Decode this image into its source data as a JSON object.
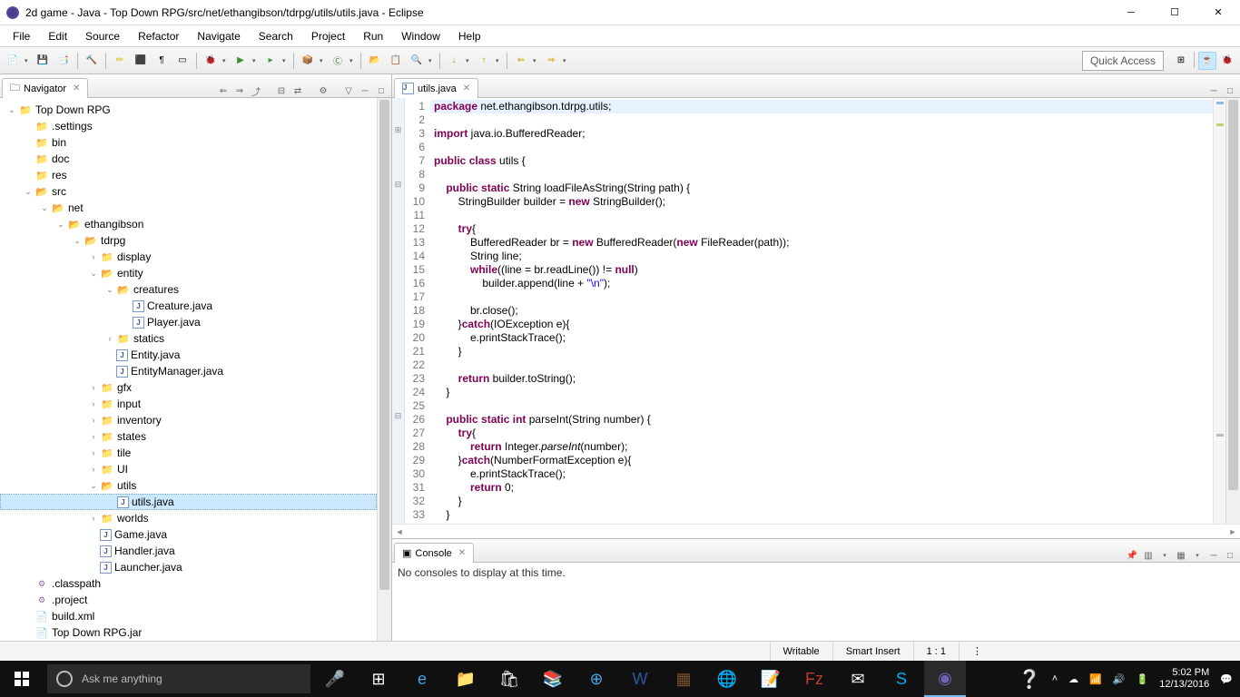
{
  "window": {
    "title": "2d game - Java - Top Down RPG/src/net/ethangibson/tdrpg/utils/utils.java - Eclipse"
  },
  "menu": [
    "File",
    "Edit",
    "Source",
    "Refactor",
    "Navigate",
    "Search",
    "Project",
    "Run",
    "Window",
    "Help"
  ],
  "quick_access": "Quick Access",
  "navigator": {
    "title": "Navigator",
    "tree": [
      {
        "d": 0,
        "t": "tw",
        "l": "Top Down RPG",
        "i": "proj",
        "exp": true
      },
      {
        "d": 1,
        "t": "lf",
        "l": ".settings",
        "i": "folder"
      },
      {
        "d": 1,
        "t": "lf",
        "l": "bin",
        "i": "folder"
      },
      {
        "d": 1,
        "t": "lf",
        "l": "doc",
        "i": "folder"
      },
      {
        "d": 1,
        "t": "lf",
        "l": "res",
        "i": "folder"
      },
      {
        "d": 1,
        "t": "tw",
        "l": "src",
        "i": "folder-open",
        "exp": true
      },
      {
        "d": 2,
        "t": "tw",
        "l": "net",
        "i": "folder-open",
        "exp": true
      },
      {
        "d": 3,
        "t": "tw",
        "l": "ethangibson",
        "i": "folder-open",
        "exp": true
      },
      {
        "d": 4,
        "t": "tw",
        "l": "tdrpg",
        "i": "folder-open",
        "exp": true
      },
      {
        "d": 5,
        "t": "lf",
        "l": "display",
        "i": "folder",
        "ch": true
      },
      {
        "d": 5,
        "t": "tw",
        "l": "entity",
        "i": "folder-open",
        "exp": true
      },
      {
        "d": 6,
        "t": "tw",
        "l": "creatures",
        "i": "folder-open",
        "exp": true
      },
      {
        "d": 7,
        "t": "lf",
        "l": "Creature.java",
        "i": "java"
      },
      {
        "d": 7,
        "t": "lf",
        "l": "Player.java",
        "i": "java"
      },
      {
        "d": 6,
        "t": "lf",
        "l": "statics",
        "i": "folder",
        "ch": true
      },
      {
        "d": 6,
        "t": "lf",
        "l": "Entity.java",
        "i": "java"
      },
      {
        "d": 6,
        "t": "lf",
        "l": "EntityManager.java",
        "i": "java"
      },
      {
        "d": 5,
        "t": "lf",
        "l": "gfx",
        "i": "folder",
        "ch": true
      },
      {
        "d": 5,
        "t": "lf",
        "l": "input",
        "i": "folder",
        "ch": true
      },
      {
        "d": 5,
        "t": "lf",
        "l": "inventory",
        "i": "folder",
        "ch": true
      },
      {
        "d": 5,
        "t": "lf",
        "l": "states",
        "i": "folder",
        "ch": true
      },
      {
        "d": 5,
        "t": "lf",
        "l": "tile",
        "i": "folder",
        "ch": true
      },
      {
        "d": 5,
        "t": "lf",
        "l": "UI",
        "i": "folder",
        "ch": true
      },
      {
        "d": 5,
        "t": "tw",
        "l": "utils",
        "i": "folder-open",
        "exp": true
      },
      {
        "d": 6,
        "t": "lf",
        "l": "utils.java",
        "i": "java",
        "sel": true
      },
      {
        "d": 5,
        "t": "lf",
        "l": "worlds",
        "i": "folder",
        "ch": true
      },
      {
        "d": 5,
        "t": "lf",
        "l": "Game.java",
        "i": "java"
      },
      {
        "d": 5,
        "t": "lf",
        "l": "Handler.java",
        "i": "java"
      },
      {
        "d": 5,
        "t": "lf",
        "l": "Launcher.java",
        "i": "java"
      },
      {
        "d": 1,
        "t": "lf",
        "l": ".classpath",
        "i": "xml"
      },
      {
        "d": 1,
        "t": "lf",
        "l": ".project",
        "i": "xml"
      },
      {
        "d": 1,
        "t": "lf",
        "l": "build.xml",
        "i": "file"
      },
      {
        "d": 1,
        "t": "lf",
        "l": "Top Down RPG.jar",
        "i": "file"
      }
    ]
  },
  "editor": {
    "tab": "utils.java",
    "lines": [
      {
        "n": 1,
        "html": "<span class='kw'>package</span> net.ethangibson.tdrpg.utils;",
        "hl": true
      },
      {
        "n": 2,
        "html": ""
      },
      {
        "n": 3,
        "html": "<span class='kw'>import</span> java.io.BufferedReader;",
        "fold": "+"
      },
      {
        "n": 6,
        "html": ""
      },
      {
        "n": 7,
        "html": "<span class='kw'>public</span> <span class='kw'>class</span> utils {"
      },
      {
        "n": 8,
        "html": ""
      },
      {
        "n": 9,
        "html": "    <span class='kw'>public</span> <span class='kw'>static</span> String loadFileAsString(String path) {",
        "fold": "-"
      },
      {
        "n": 10,
        "html": "        StringBuilder builder = <span class='kw'>new</span> StringBuilder();"
      },
      {
        "n": 11,
        "html": ""
      },
      {
        "n": 12,
        "html": "        <span class='kw'>try</span>{"
      },
      {
        "n": 13,
        "html": "            BufferedReader br = <span class='kw'>new</span> BufferedReader(<span class='kw'>new</span> FileReader(path));"
      },
      {
        "n": 14,
        "html": "            String line;"
      },
      {
        "n": 15,
        "html": "            <span class='kw'>while</span>((line = br.readLine()) != <span class='kw'>null</span>)"
      },
      {
        "n": 16,
        "html": "                builder.append(line + <span class='str'>\"\\n\"</span>);"
      },
      {
        "n": 17,
        "html": ""
      },
      {
        "n": 18,
        "html": "            br.close();"
      },
      {
        "n": 19,
        "html": "        }<span class='kw'>catch</span>(IOException e){"
      },
      {
        "n": 20,
        "html": "            e.printStackTrace();"
      },
      {
        "n": 21,
        "html": "        }"
      },
      {
        "n": 22,
        "html": ""
      },
      {
        "n": 23,
        "html": "        <span class='kw'>return</span> builder.toString();"
      },
      {
        "n": 24,
        "html": "    }"
      },
      {
        "n": 25,
        "html": ""
      },
      {
        "n": 26,
        "html": "    <span class='kw'>public</span> <span class='kw'>static</span> <span class='kw'>int</span> parseInt(String number) {",
        "fold": "-"
      },
      {
        "n": 27,
        "html": "        <span class='kw'>try</span>{"
      },
      {
        "n": 28,
        "html": "            <span class='kw'>return</span> Integer.<i>parseInt</i>(number);"
      },
      {
        "n": 29,
        "html": "        }<span class='kw'>catch</span>(NumberFormatException e){"
      },
      {
        "n": 30,
        "html": "            e.printStackTrace();"
      },
      {
        "n": 31,
        "html": "            <span class='kw'>return</span> 0;"
      },
      {
        "n": 32,
        "html": "        }"
      },
      {
        "n": 33,
        "html": "    }"
      }
    ]
  },
  "console": {
    "title": "Console",
    "body": "No consoles to display at this time."
  },
  "status": {
    "writable": "Writable",
    "insert": "Smart Insert",
    "pos": "1 : 1"
  },
  "taskbar": {
    "cortana": "Ask me anything",
    "time": "5:02 PM",
    "date": "12/13/2016"
  }
}
